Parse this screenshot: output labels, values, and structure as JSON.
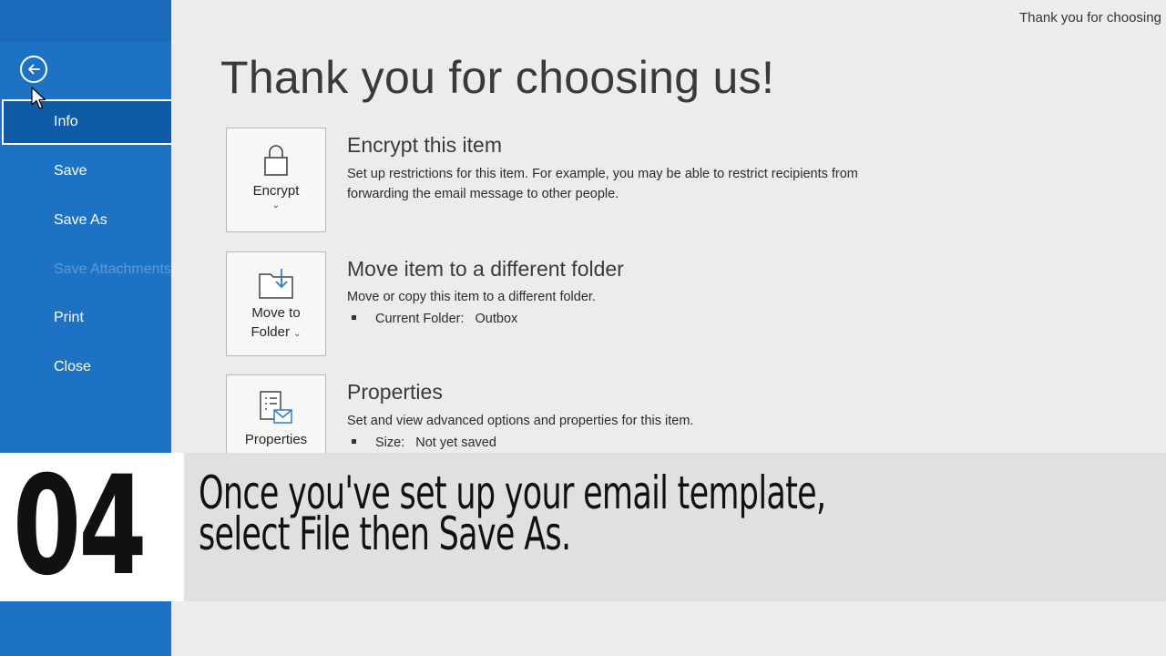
{
  "window_title": "Thank you for choosing",
  "sidebar": {
    "back_icon": "back-arrow-icon",
    "items": [
      {
        "label": "Info",
        "state": "active"
      },
      {
        "label": "Save",
        "state": "normal"
      },
      {
        "label": "Save As",
        "state": "normal"
      },
      {
        "label": "Save Attachments",
        "state": "disabled"
      },
      {
        "label": "Print",
        "state": "normal"
      },
      {
        "label": "Close",
        "state": "normal"
      }
    ]
  },
  "main": {
    "heading": "Thank you for choosing us!",
    "sections": [
      {
        "button_label": "Encrypt",
        "button_icon": "lock-icon",
        "title": "Encrypt this item",
        "description": "Set up restrictions for this item. For example, you may be able to restrict recipients from forwarding the email message to other people."
      },
      {
        "button_label_line1": "Move to",
        "button_label_line2": "Folder",
        "button_icon": "move-to-folder-icon",
        "title": "Move item to a different folder",
        "description": "Move or copy this item to a different folder.",
        "meta_label": "Current Folder:",
        "meta_value": "Outbox"
      },
      {
        "button_label": "Properties",
        "button_icon": "properties-icon",
        "title": "Properties",
        "description": "Set and view advanced options and properties for this item.",
        "meta_label": "Size:",
        "meta_value": "Not yet saved"
      }
    ]
  },
  "caption": {
    "step": "04",
    "line1": "Once you've set up your email template,",
    "line2": "select File then Save As."
  },
  "colors": {
    "sidebar": "#1e72c4",
    "sidebar_active": "#0f5ba7",
    "background": "#ececec",
    "caption_band": "#e0e0e0"
  }
}
